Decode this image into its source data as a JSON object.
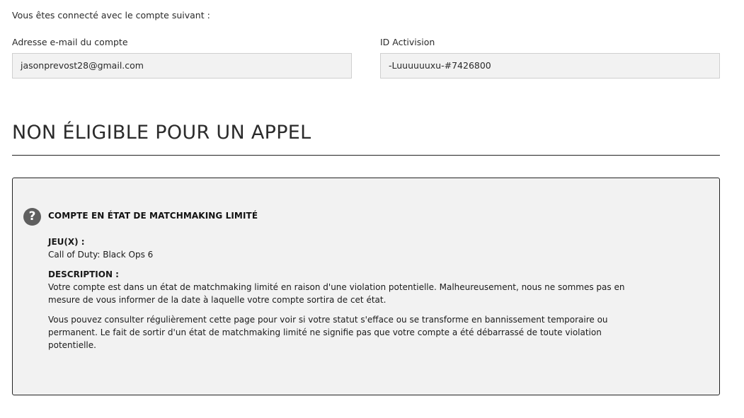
{
  "account": {
    "intro": "Vous êtes connecté avec le compte suivant :",
    "email_label": "Adresse e-mail du compte",
    "email_value": "jasonprevost28@gmail.com",
    "activision_label": "ID Activision",
    "activision_value": "-Luuuuuuxu-#7426800"
  },
  "appeal": {
    "heading": "NON ÉLIGIBLE POUR UN APPEL"
  },
  "status": {
    "icon": "question-icon",
    "title": "COMPTE EN ÉTAT DE MATCHMAKING LIMITÉ",
    "games_label": "JEU(X) :",
    "games_value": "Call of Duty: Black Ops 6",
    "description_label": "DESCRIPTION :",
    "description_paragraphs": [
      "Votre compte est dans un état de matchmaking limité en raison d'une violation potentielle. Malheureusement, nous ne sommes pas en mesure de vous informer de la date à laquelle votre compte sortira de cet état.",
      "Vous pouvez consulter régulièrement cette page pour voir si votre statut s'efface ou se transforme en bannissement temporaire ou permanent. Le fait de sortir d'un état de matchmaking limité ne signifie pas que votre compte a été débarrassé de toute violation potentielle."
    ]
  },
  "colors": {
    "panel_background": "#f2f2f2",
    "field_background": "#f2f2f2",
    "icon_background": "#5f5f5f",
    "border": "#222222"
  }
}
